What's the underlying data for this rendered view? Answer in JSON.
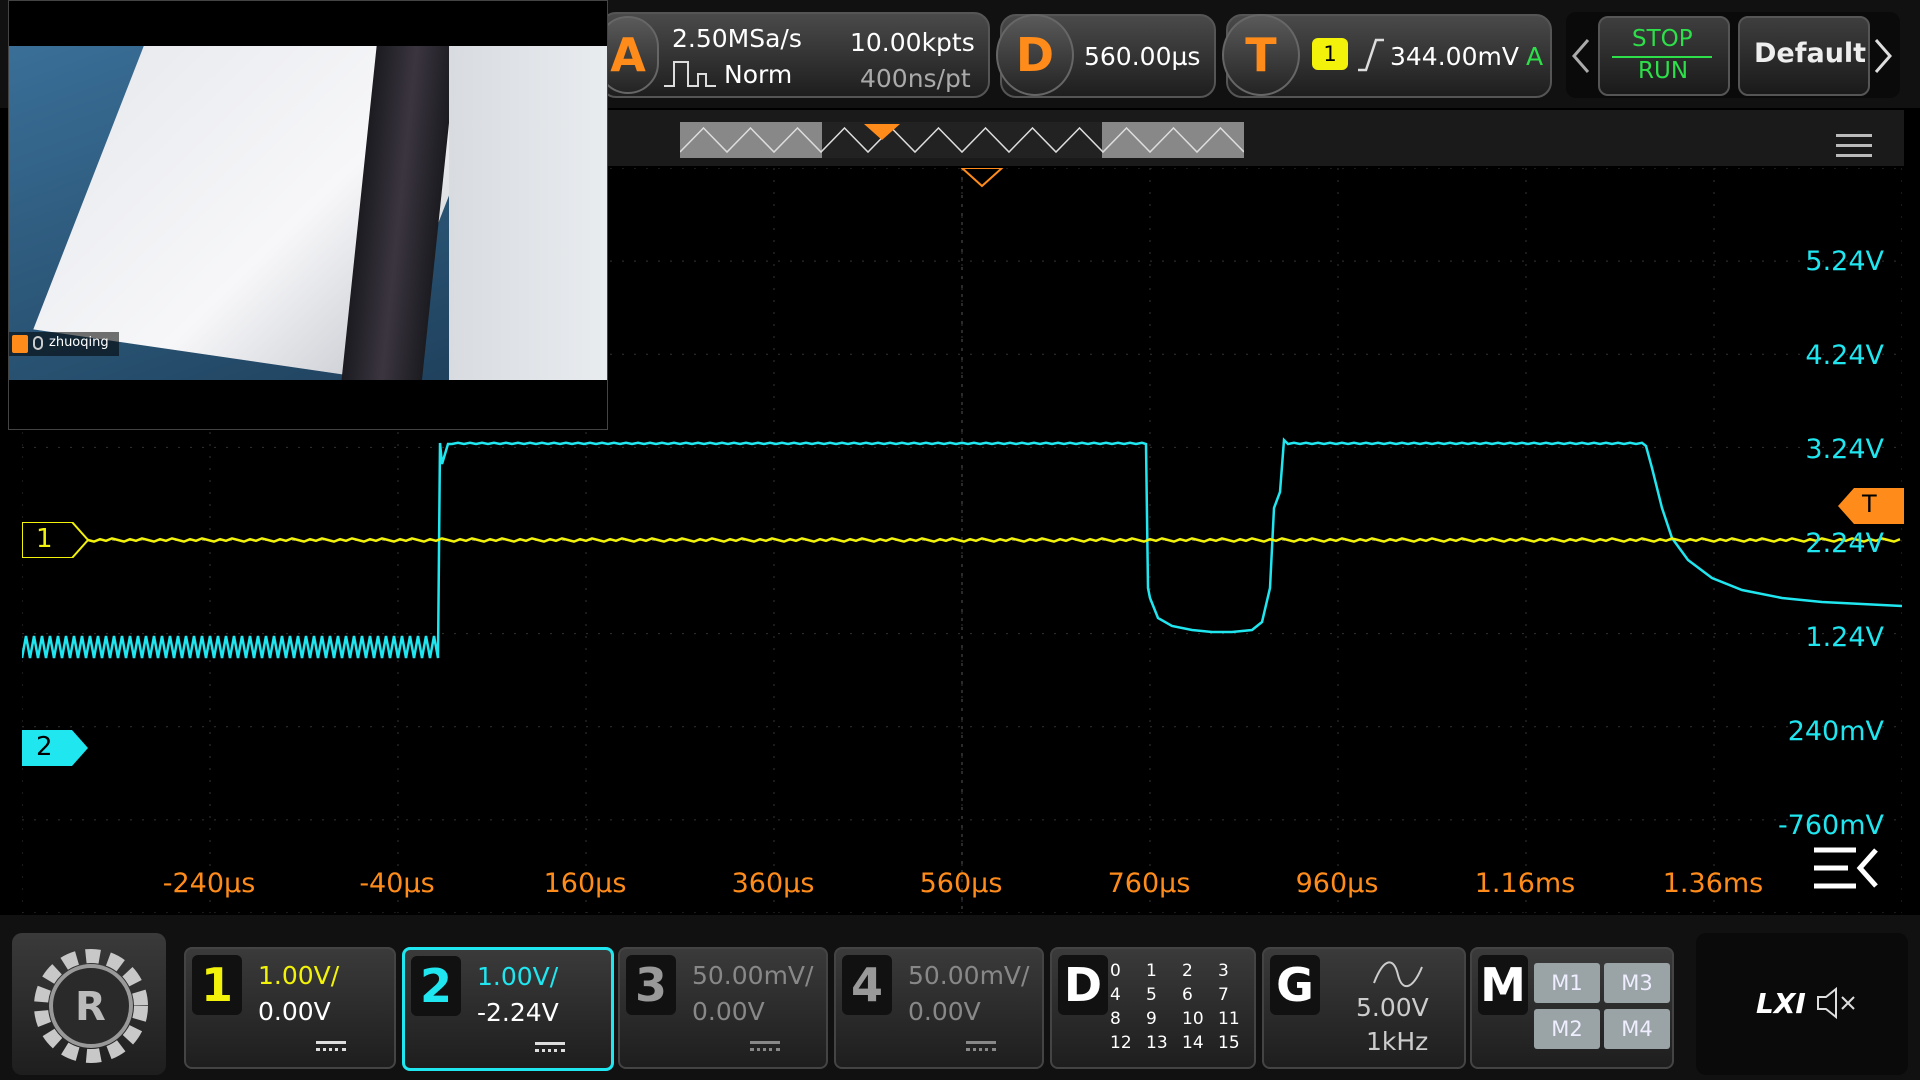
{
  "top": {
    "acq": {
      "letter": "A",
      "rate": "2.50MSa/s",
      "mode": "Norm",
      "points": "10.00kpts",
      "ptime": "400ns/pt"
    },
    "delay": {
      "letter": "D",
      "value": "560.00µs"
    },
    "trigger": {
      "letter": "T",
      "channel": "1",
      "level": "344.00mV",
      "mode": "A"
    },
    "stop_label": "STOP",
    "run_label": "RUN",
    "default_label": "Default"
  },
  "webcam": {
    "user": "zhuoqing"
  },
  "scope": {
    "ch1_marker": "1",
    "ch2_marker": "2",
    "trig_marker": "T",
    "right_labels": [
      "5.24V",
      "4.24V",
      "3.24V",
      "2.24V",
      "1.24V",
      "240mV",
      "-760mV"
    ],
    "time_labels": [
      "-240µs",
      "-40µs",
      "160µs",
      "360µs",
      "560µs",
      "760µs",
      "960µs",
      "1.16ms",
      "1.36ms"
    ]
  },
  "channels": [
    {
      "num": "1",
      "scale": "1.00V/",
      "offset": "0.00V",
      "color": "#f2f20a"
    },
    {
      "num": "2",
      "scale": "1.00V/",
      "offset": "-2.24V",
      "color": "#20e6f0"
    },
    {
      "num": "3",
      "scale": "50.00mV/",
      "offset": "0.00V",
      "color": "#888888"
    },
    {
      "num": "4",
      "scale": "50.00mV/",
      "offset": "0.00V",
      "color": "#888888"
    }
  ],
  "digital": {
    "letter": "D",
    "bits": [
      "0",
      "1",
      "2",
      "3",
      "4",
      "5",
      "6",
      "7",
      "8",
      "9",
      "10",
      "11",
      "12",
      "13",
      "14",
      "15"
    ]
  },
  "generator": {
    "letter": "G",
    "amplitude": "5.00V",
    "frequency": "1kHz"
  },
  "math": {
    "letter": "M",
    "items": [
      "M1",
      "M3",
      "M2",
      "M4"
    ]
  },
  "lxi": {
    "label": "LXI"
  },
  "colors": {
    "ch1": "#f2f20a",
    "ch2": "#20e6f0",
    "accent": "#ff8c1a",
    "run": "#2de04a"
  }
}
